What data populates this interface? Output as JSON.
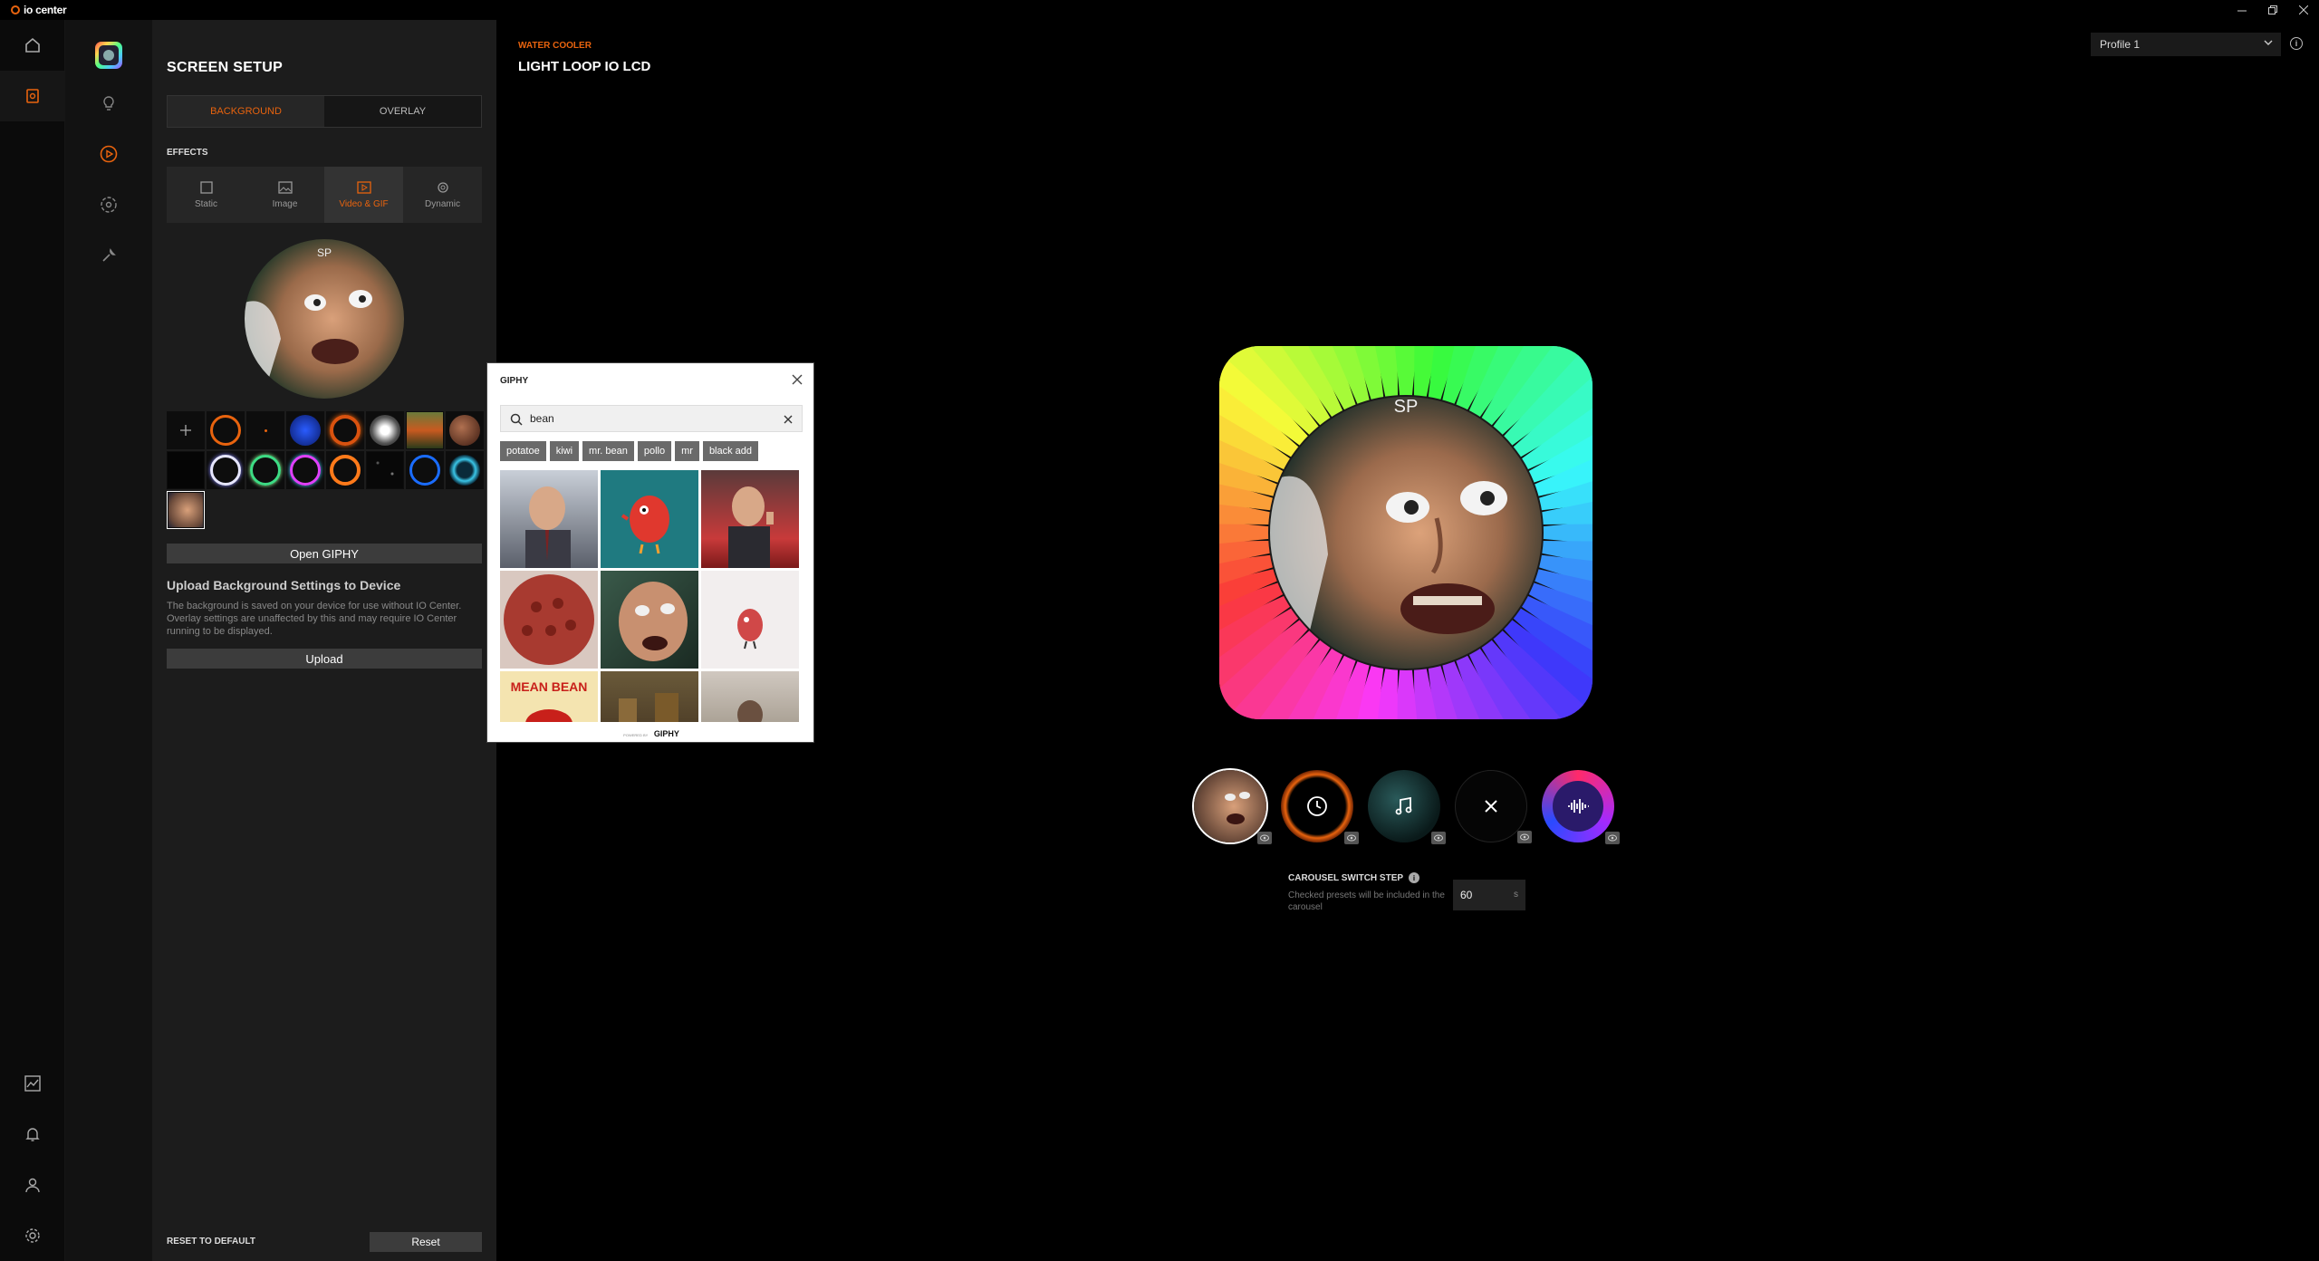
{
  "app": {
    "title": "io center"
  },
  "window_controls": [
    "minimize-icon",
    "restore-icon",
    "close-icon"
  ],
  "panel": {
    "title": "SCREEN SETUP",
    "tabs": [
      {
        "label": "BACKGROUND",
        "active": true
      },
      {
        "label": "OVERLAY",
        "active": false
      }
    ],
    "effects_label": "EFFECTS",
    "effects": [
      {
        "label": "Static",
        "icon": "square-icon",
        "active": false
      },
      {
        "label": "Image",
        "icon": "image-icon",
        "active": false
      },
      {
        "label": "Video & GIF",
        "icon": "video-icon",
        "active": true
      },
      {
        "label": "Dynamic",
        "icon": "dynamic-icon",
        "active": false
      }
    ],
    "preview_text": "SP",
    "open_giphy_label": "Open GIPHY",
    "upload_title": "Upload Background Settings to Device",
    "upload_desc": "The background is saved on your device for use without IO Center. Overlay settings are unaffected by this and may require IO Center running to be displayed.",
    "upload_label": "Upload",
    "reset_label": "RESET TO DEFAULT",
    "reset_button": "Reset"
  },
  "main": {
    "category": "WATER COOLER",
    "title": "LIGHT LOOP IO LCD",
    "profile": "Profile 1",
    "info": "i",
    "lcd_text": "SP",
    "carousel": [
      {
        "name": "mr-bean-gif",
        "icon": "eye-icon"
      },
      {
        "name": "clock",
        "icon": "eye-icon"
      },
      {
        "name": "music",
        "icon": "eye-icon"
      },
      {
        "name": "none",
        "icon": "eye-icon"
      },
      {
        "name": "audio-visualizer",
        "icon": "eye-icon"
      }
    ],
    "carousel_step": {
      "label": "CAROUSEL SWITCH STEP",
      "desc": "Checked presets will be included in the carousel",
      "value": "60",
      "unit": "s"
    }
  },
  "giphy": {
    "title": "GIPHY",
    "search_value": "bean",
    "tags": [
      "potatoe",
      "kiwi",
      "mr. bean",
      "pollo",
      "mr",
      "black add"
    ],
    "powered_prefix": "POWERED BY",
    "footer": "GIPHY"
  },
  "colors": {
    "accent": "#e8630e",
    "panel": "#1c1c1c",
    "background": "#000000"
  }
}
